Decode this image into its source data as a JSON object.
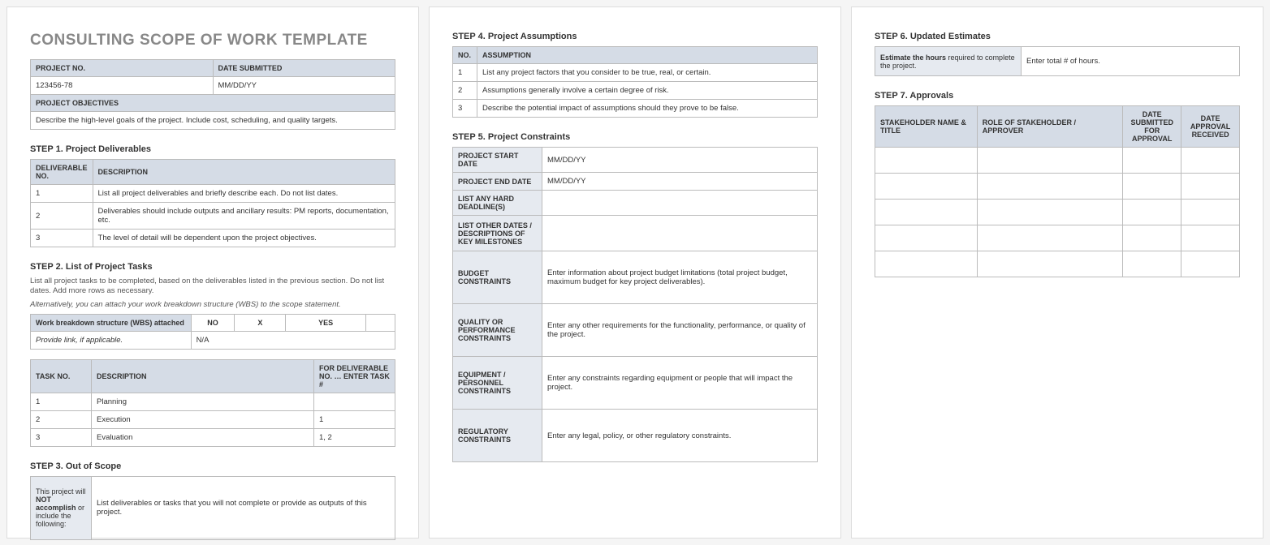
{
  "title": "CONSULTING SCOPE OF WORK TEMPLATE",
  "header_table": {
    "project_no_label": "PROJECT NO.",
    "date_submitted_label": "DATE SUBMITTED",
    "project_no": "123456-78",
    "date_submitted": "MM/DD/YY",
    "objectives_label": "PROJECT OBJECTIVES",
    "objectives_text": "Describe the high-level goals of the project.  Include cost, scheduling, and quality targets."
  },
  "step1": {
    "title": "STEP 1.  Project Deliverables",
    "cols": {
      "no": "DELIVERABLE NO.",
      "desc": "DESCRIPTION"
    },
    "rows": [
      {
        "no": "1",
        "desc": "List all project deliverables and briefly describe each. Do not list dates."
      },
      {
        "no": "2",
        "desc": "Deliverables should include outputs and ancillary results: PM reports, documentation, etc."
      },
      {
        "no": "3",
        "desc": "The level of detail will be dependent upon the project objectives."
      }
    ]
  },
  "step2": {
    "title": "STEP 2.  List of Project Tasks",
    "sub1": "List all project tasks to be completed, based on the deliverables listed in the previous section. Do not list dates. Add more rows as necessary.",
    "sub2": "Alternatively, you can attach your work breakdown structure (WBS) to the scope statement.",
    "wbs": {
      "label": "Work breakdown structure (WBS) attached",
      "no": "NO",
      "x": "X",
      "yes": "YES",
      "empty": "",
      "provide": "Provide link, if applicable.",
      "na": "N/A"
    },
    "cols": {
      "task": "TASK NO.",
      "desc": "DESCRIPTION",
      "for": "FOR DELIVERABLE NO. … ENTER TASK #"
    },
    "rows": [
      {
        "no": "1",
        "desc": "Planning",
        "for": ""
      },
      {
        "no": "2",
        "desc": "Execution",
        "for": "1"
      },
      {
        "no": "3",
        "desc": "Evaluation",
        "for": "1, 2"
      }
    ]
  },
  "step3": {
    "title": "STEP 3.  Out of Scope",
    "label": "This project will NOT accomplish or include the following:",
    "text": "List deliverables or tasks that you will not complete or provide as outputs of this project."
  },
  "step4": {
    "title": "STEP 4.  Project Assumptions",
    "cols": {
      "no": "NO.",
      "assump": "ASSUMPTION"
    },
    "rows": [
      {
        "no": "1",
        "text": "List any project factors that you consider to be true, real, or certain."
      },
      {
        "no": "2",
        "text": "Assumptions generally involve a certain degree of risk."
      },
      {
        "no": "3",
        "text": "Describe the potential impact of assumptions should they prove to be false."
      }
    ]
  },
  "step5": {
    "title": "STEP 5.  Project Constraints",
    "rows": {
      "start_label": "PROJECT START DATE",
      "start_val": "MM/DD/YY",
      "end_label": "PROJECT END DATE",
      "end_val": "MM/DD/YY",
      "hard_label": "LIST ANY HARD DEADLINE(S)",
      "hard_val": "",
      "other_label": "LIST OTHER DATES / DESCRIPTIONS OF KEY MILESTONES",
      "other_val": "",
      "budget_label": "BUDGET CONSTRAINTS",
      "budget_val": "Enter information about project budget limitations (total project budget, maximum budget for key project deliverables).",
      "quality_label": "QUALITY OR PERFORMANCE CONSTRAINTS",
      "quality_val": "Enter any other requirements for the functionality, performance, or quality of the project.",
      "equip_label": "EQUIPMENT / PERSONNEL CONSTRAINTS",
      "equip_val": "Enter any constraints regarding equipment or people that will impact the project.",
      "reg_label": "REGULATORY CONSTRAINTS",
      "reg_val": "Enter any legal, policy, or other regulatory constraints."
    }
  },
  "step6": {
    "title": "STEP 6.  Updated Estimates",
    "label": "Estimate the hours required to complete the project.",
    "val": "Enter total # of hours."
  },
  "step7": {
    "title": "STEP 7.  Approvals",
    "cols": {
      "name": "STAKEHOLDER NAME & TITLE",
      "role": "ROLE OF STAKEHOLDER / APPROVER",
      "submitted": "DATE SUBMITTED FOR APPROVAL",
      "received": "DATE APPROVAL RECEIVED"
    }
  }
}
